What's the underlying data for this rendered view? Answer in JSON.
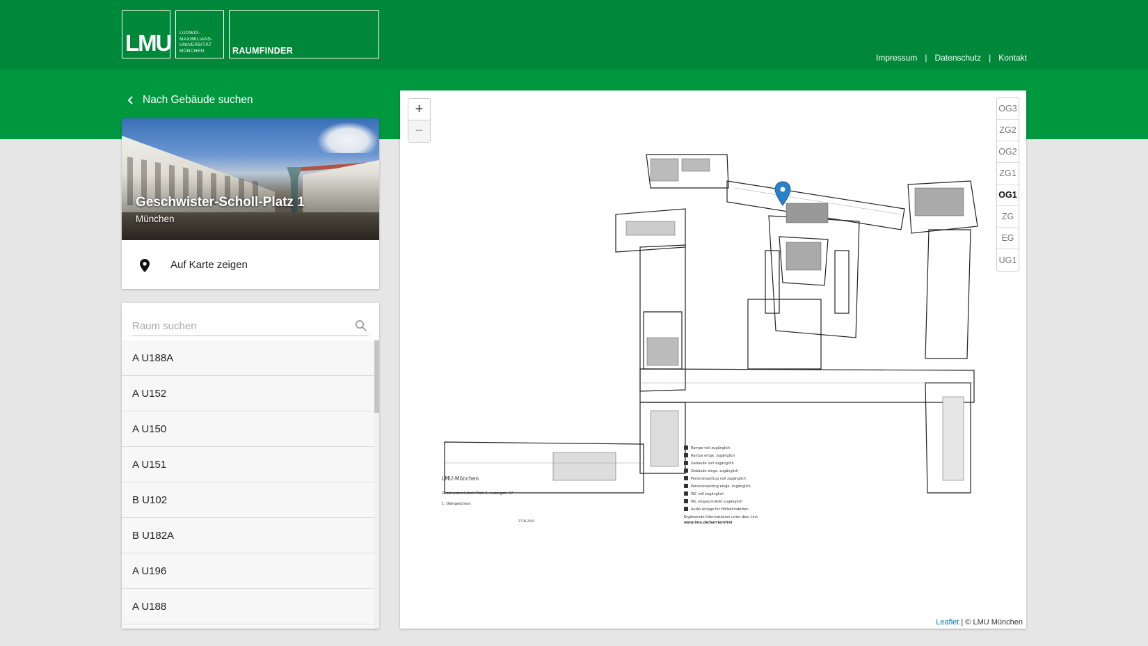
{
  "header": {
    "logo_short": "LMU",
    "logo_name_lines": [
      "LUDWIG-",
      "MAXIMILIANS-",
      "UNIVERSITÄT",
      "MÜNCHEN"
    ],
    "app_name": "RAUMFINDER",
    "links": [
      "Impressum",
      "Datenschutz",
      "Kontakt"
    ],
    "separator": "|"
  },
  "nav": {
    "back_label": "Nach Gebäude suchen"
  },
  "building": {
    "name": "Geschwister-Scholl-Platz 1",
    "city": "München",
    "show_map_label": "Auf Karte zeigen"
  },
  "rooms": {
    "search_placeholder": "Raum suchen",
    "items": [
      "A U188A",
      "A U152",
      "A U150",
      "A U151",
      "B U102",
      "B U182A",
      "A U196",
      "A U188"
    ],
    "scroll_position": 0
  },
  "map": {
    "zoom_in": "+",
    "zoom_out": "−",
    "floors": [
      "OG3",
      "ZG2",
      "OG2",
      "ZG1",
      "OG1",
      "ZG",
      "EG",
      "UG1"
    ],
    "active_floor": "OG1",
    "attribution_link": "Leaflet",
    "attribution_text": "© LMU München",
    "attribution_sep": "|",
    "plan_title": "LMU-München",
    "plan_address": "Geschwister-Scholl-Platz 1, Ludwigstr. 27",
    "plan_floor": "1. Obergeschoss",
    "plan_date": "27.04.2016",
    "legend": [
      "Rampe voll zugänglich",
      "Rampe einge. zugänglich",
      "Gebäude voll zugänglich",
      "Gebäude einge. zugänglich",
      "Personenaufzug voll zugänglich",
      "Personenaufzug einge. zugänglich",
      "WC voll zugänglich",
      "WC eingeschränkt zugänglich",
      "Audio Anlage für Hörbehinderten",
      "Ergänzende Informationen unter dem Link",
      "www.lmu.de/barrierefrei"
    ]
  },
  "colors": {
    "header_dark": "#00883a",
    "header_band": "#00983f",
    "marker": "#2a81cb"
  }
}
